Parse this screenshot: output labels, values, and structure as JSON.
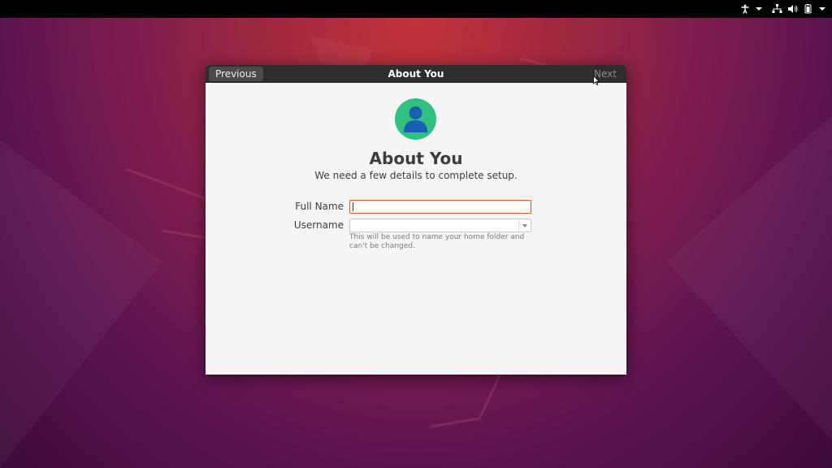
{
  "topbar": {
    "icons": [
      "accessibility-icon",
      "chevron-down-icon",
      "network-icon",
      "volume-icon",
      "battery-icon",
      "chevron-down-icon"
    ]
  },
  "window": {
    "title": "About You",
    "previous_label": "Previous",
    "next_label": "Next",
    "next_enabled": false
  },
  "page": {
    "avatar_icon": "user-avatar-icon",
    "avatar_color": "#2ec27e",
    "heading": "About You",
    "subheading": "We need a few details to complete setup."
  },
  "form": {
    "full_name_label": "Full Name",
    "full_name_value": "",
    "username_label": "Username",
    "username_value": "",
    "username_hint": "This will be used to name your home folder and can't be changed."
  },
  "colors": {
    "focus_accent": "#e95420",
    "headerbar": "#2d2d2d"
  }
}
